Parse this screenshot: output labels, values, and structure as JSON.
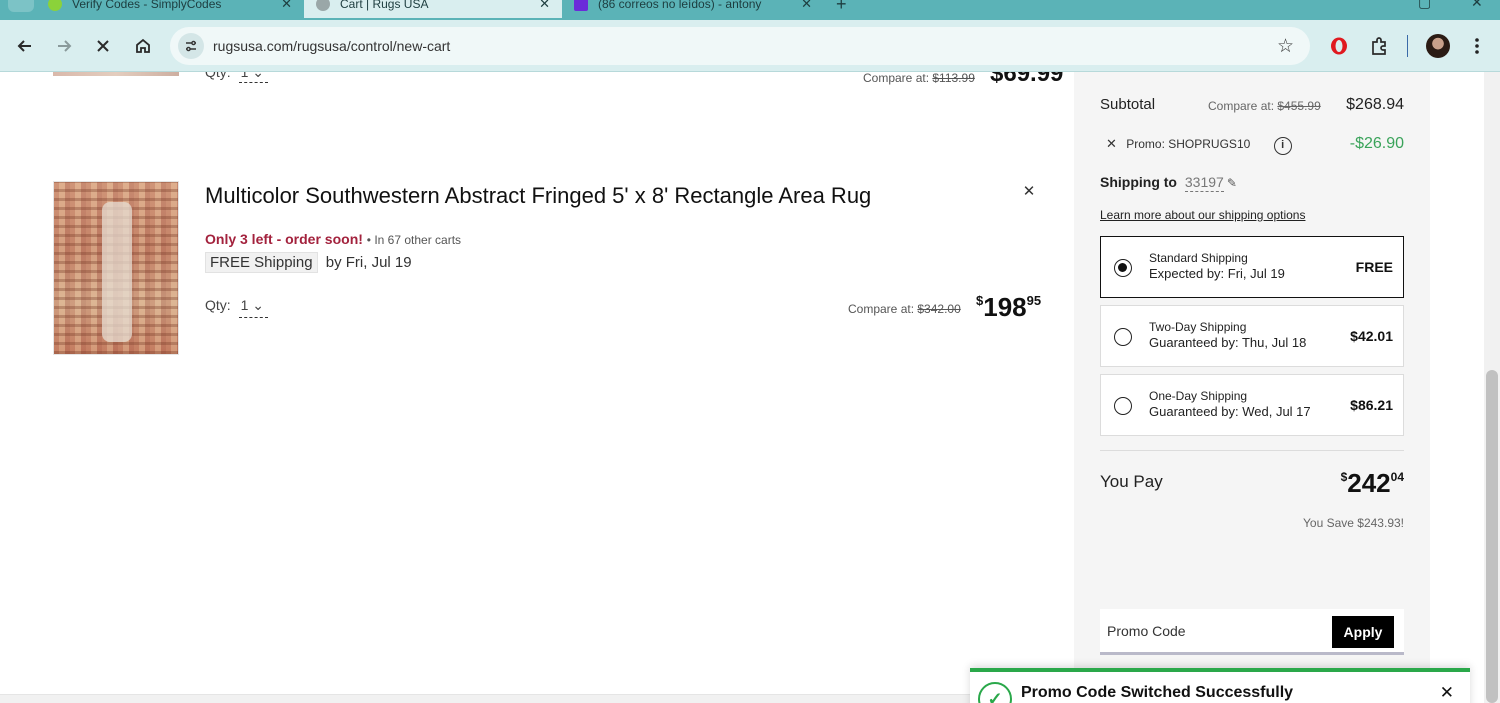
{
  "browser": {
    "tabs": [
      {
        "label": "Verify Codes - SimplyCodes",
        "favicon_color": "#8bd23a",
        "close": "✕"
      },
      {
        "label": "Cart | Rugs USA",
        "favicon_color": "#9aa7a8",
        "close": "✕"
      },
      {
        "label": "(86 correos no leídos) - antony",
        "favicon_color": "#6b2bd9",
        "close": "✕"
      }
    ],
    "new_tab": "+",
    "url": "rugsusa.com/rugsusa/control/new-cart",
    "icons": [
      "back-icon",
      "forward-icon",
      "stop-icon",
      "home-icon",
      "site-info-icon",
      "star-icon",
      "opera-icon",
      "extensions-icon",
      "profile-avatar",
      "kebab-menu-icon"
    ]
  },
  "previous_item": {
    "qty_label": "Qty:",
    "qty_value": "1",
    "compare_label": "Compare at:",
    "compare_price": "$113.99",
    "price": "$69.99"
  },
  "item": {
    "title": "Multicolor Southwestern Abstract Fringed 5' x 8' Rectangle Area Rug",
    "stock_warning": "Only 3 left - order soon!",
    "carts_note": "• In 67 other carts",
    "free_shipping": "FREE Shipping",
    "delivery": "by Fri, Jul 19",
    "qty_label": "Qty:",
    "qty_value": "1",
    "compare_label": "Compare at:",
    "compare_price": "$342.00",
    "price_symbol": "$",
    "price_main": "198",
    "price_cents": "95",
    "remove": "✕"
  },
  "summary": {
    "subtotal_label": "Subtotal",
    "subtotal_compare_label": "Compare at:",
    "subtotal_compare": "$455.99",
    "subtotal_value": "$268.94",
    "promo_remove": "✕",
    "promo_label": "Promo: SHOPRUGS10",
    "promo_info": "i",
    "promo_discount": "-$26.90",
    "shipping_to_label": "Shipping to",
    "zip": "33197",
    "learn_more": "Learn more about our shipping options",
    "shipping_options": [
      {
        "name": "Standard Shipping",
        "date": "Expected by: Fri, Jul 19",
        "price": "FREE",
        "selected": true
      },
      {
        "name": "Two-Day Shipping",
        "date": "Guaranteed by: Thu, Jul 18",
        "price": "$42.01",
        "selected": false
      },
      {
        "name": "One-Day Shipping",
        "date": "Guaranteed by: Wed, Jul 17",
        "price": "$86.21",
        "selected": false
      }
    ],
    "you_pay_label": "You Pay",
    "you_pay_symbol": "$",
    "you_pay_main": "242",
    "you_pay_cents": "04",
    "you_save": "You Save $243.93!",
    "promo_placeholder": "Promo Code",
    "apply_label": "Apply"
  },
  "toast": {
    "message": "Promo Code Switched Successfully",
    "close": "✕",
    "accent": "#2aa84a"
  }
}
